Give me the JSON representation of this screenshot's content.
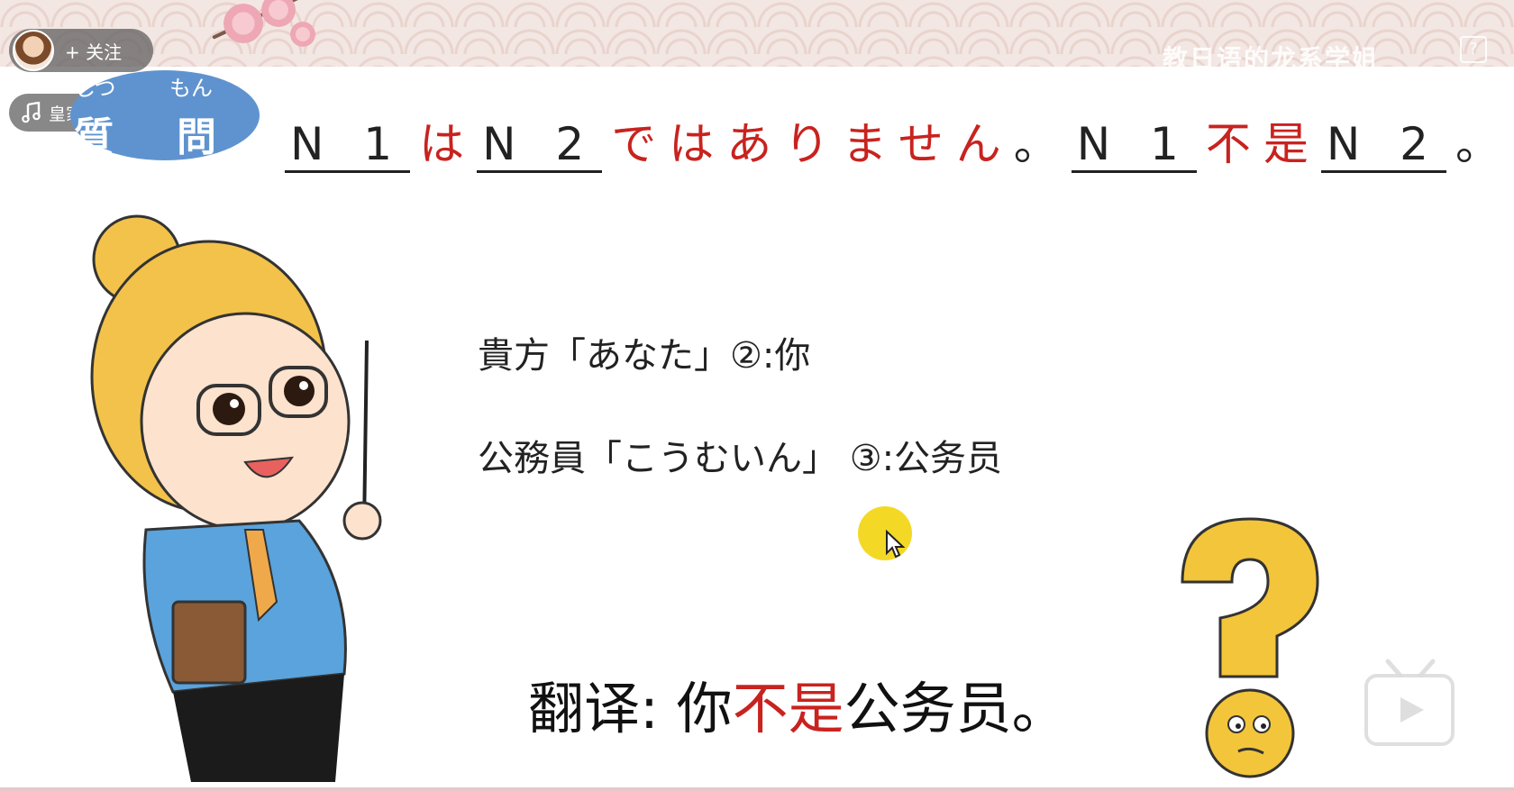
{
  "overlay": {
    "follow_label": "+ 关注",
    "music_label": "皇家萌卫",
    "watermark_text": "教日语的龙系学姐",
    "help_label": "?"
  },
  "question_badge": {
    "kanji_1": "質",
    "kanji_2": "問",
    "furigana_1": "しつ",
    "furigana_2": "もん"
  },
  "title": {
    "n1": "N 1",
    "wa": "は",
    "n2": "N 2",
    "dewa_arimasen": "ではありません",
    "period_jp": "。",
    "n1_b": "N 1",
    "bushi": "不是",
    "n2_b": "N 2",
    "period_b": "。"
  },
  "vocab": [
    {
      "text": "貴方「あなた」②:你"
    },
    {
      "text": "公務員「こうむいん」 ③:公务员"
    }
  ],
  "translation": {
    "prefix": "翻译:",
    "you": "你",
    "not_is": "不是",
    "rest": "公务员。"
  },
  "colors": {
    "accent_red": "#c8231f",
    "badge_blue": "#5f93cf",
    "cursor_yellow": "#f1d200"
  }
}
